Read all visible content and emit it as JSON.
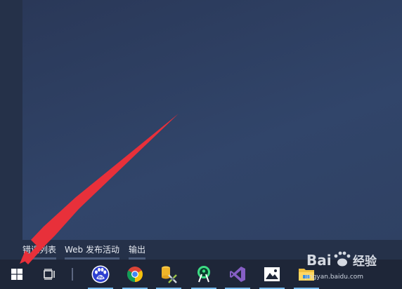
{
  "panel_tabs": [
    {
      "label": "错误列表"
    },
    {
      "label": "Web 发布活动"
    },
    {
      "label": "输出"
    }
  ],
  "taskbar": {
    "items": [
      {
        "name": "start-button",
        "icon": "windows-logo-icon"
      },
      {
        "name": "task-view-button",
        "icon": "task-view-icon"
      },
      {
        "name": "baidu-browser",
        "icon": "baidu-paw-icon"
      },
      {
        "name": "chrome",
        "icon": "chrome-icon"
      },
      {
        "name": "tools-app",
        "icon": "database-tools-icon"
      },
      {
        "name": "android-studio",
        "icon": "android-studio-icon"
      },
      {
        "name": "visual-studio",
        "icon": "visual-studio-icon"
      },
      {
        "name": "photos",
        "icon": "photos-icon"
      },
      {
        "name": "file-explorer",
        "icon": "folder-icon"
      }
    ]
  },
  "watermark": {
    "brand_left": "Bai",
    "brand_right": "经验",
    "sub": "jingyan.baidu.com"
  },
  "colors": {
    "desktop": "#2a3855",
    "taskbar": "#1e2638",
    "arrow": "#e8303a",
    "running_indicator": "#76b9ed"
  }
}
